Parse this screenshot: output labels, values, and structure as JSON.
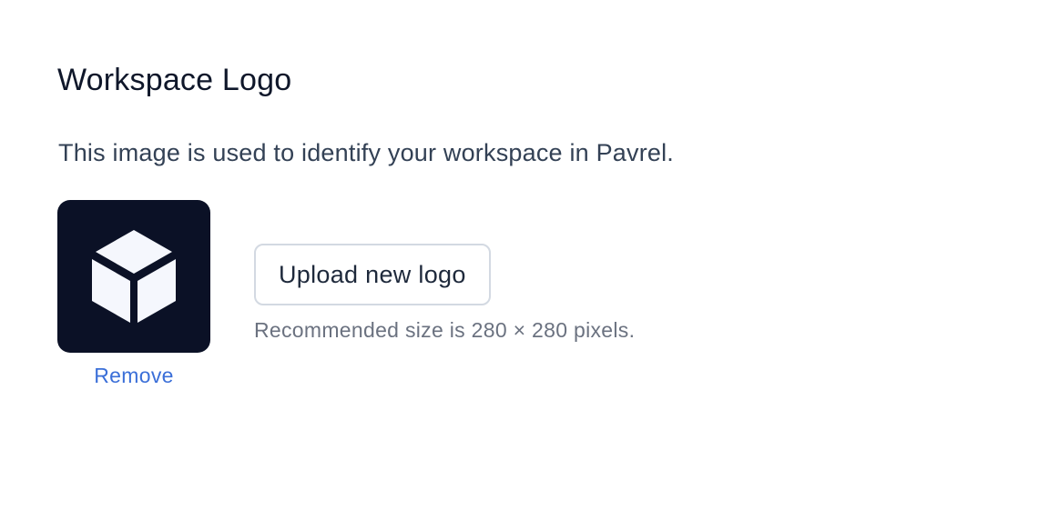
{
  "section": {
    "title": "Workspace Logo",
    "description": "This image is used to identify your workspace in Pavrel."
  },
  "logo": {
    "icon": "cube-icon",
    "tile_color": "#0b1126",
    "icon_color": "#f5f7fd",
    "remove_label": "Remove"
  },
  "upload": {
    "button_label": "Upload new logo",
    "hint": "Recommended size is 280 × 280 pixels."
  },
  "colors": {
    "link": "#3b6fd8",
    "heading": "#0f172a",
    "muted": "#6b7280"
  }
}
